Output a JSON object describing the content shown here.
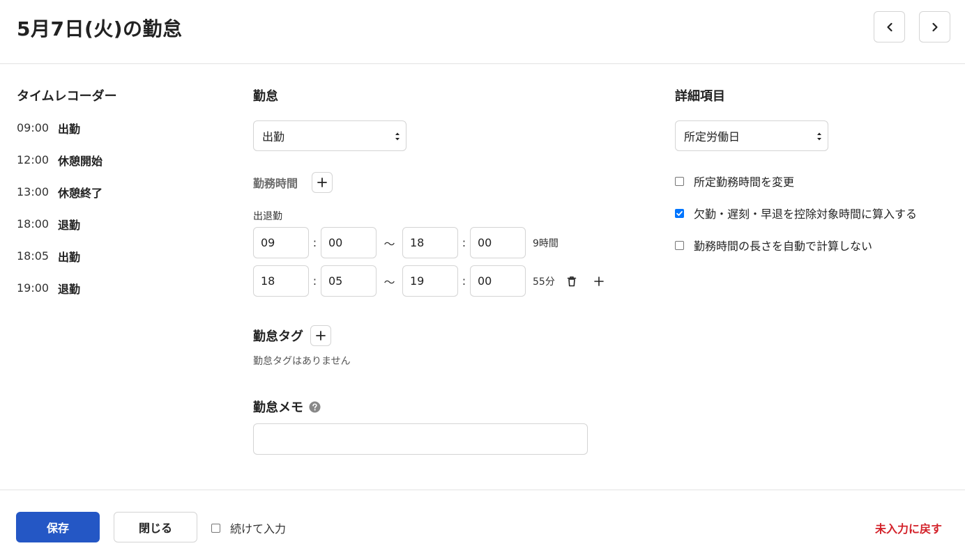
{
  "header": {
    "title": "5月7日(火)の勤怠",
    "prev_icon": "chevron-left-icon",
    "next_icon": "chevron-right-icon"
  },
  "time_recorder": {
    "title": "タイムレコーダー",
    "entries": [
      {
        "time": "09:00",
        "type": "出勤"
      },
      {
        "time": "12:00",
        "type": "休憩開始"
      },
      {
        "time": "13:00",
        "type": "休憩終了"
      },
      {
        "time": "18:00",
        "type": "退勤"
      },
      {
        "time": "18:05",
        "type": "出勤"
      },
      {
        "time": "19:00",
        "type": "退勤"
      }
    ]
  },
  "attendance": {
    "title": "勤怠",
    "status_value": "出勤",
    "work_time": {
      "title": "勤務時間",
      "clock_label": "出退勤",
      "rows": [
        {
          "start_h": "09",
          "start_m": "00",
          "end_h": "18",
          "end_m": "00",
          "duration": "9時間"
        },
        {
          "start_h": "18",
          "start_m": "05",
          "end_h": "19",
          "end_m": "00",
          "duration": "55分"
        }
      ],
      "colon": ":",
      "tilde": "〜"
    },
    "tags": {
      "title": "勤怠タグ",
      "empty_text": "勤怠タグはありません"
    },
    "memo": {
      "title": "勤怠メモ",
      "value": ""
    }
  },
  "details": {
    "title": "詳細項目",
    "day_type_value": "所定労働日",
    "checkboxes": [
      {
        "label": "所定勤務時間を変更",
        "checked": false
      },
      {
        "label": "欠勤・遅刻・早退を控除対象時間に算入する",
        "checked": true
      },
      {
        "label": "勤務時間の長さを自動で計算しない",
        "checked": false
      }
    ]
  },
  "footer": {
    "save_label": "保存",
    "close_label": "閉じる",
    "continue_label": "続けて入力",
    "continue_checked": false,
    "revert_label": "未入力に戻す"
  },
  "colors": {
    "primary": "#2457c5",
    "danger": "#d3222a",
    "checkbox_checked": "#0075ff"
  }
}
